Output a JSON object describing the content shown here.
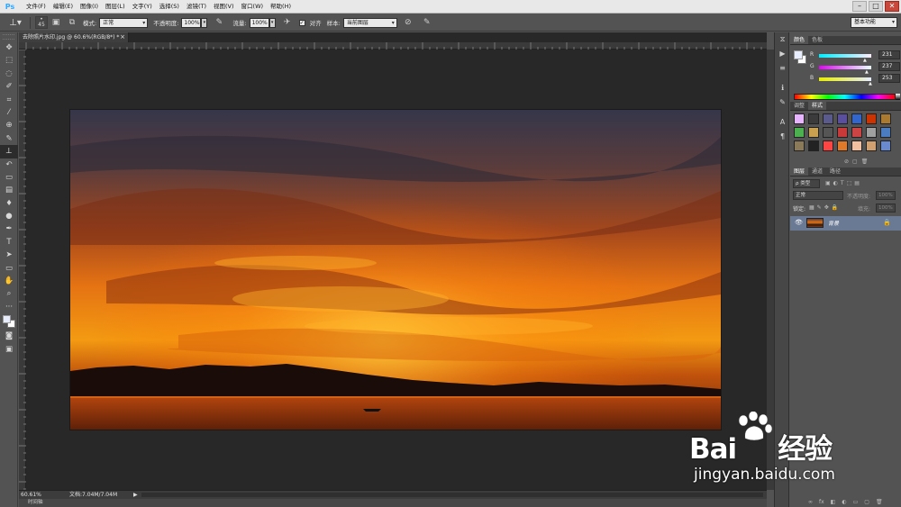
{
  "app": {
    "logo": "Ps",
    "menu": [
      "文件(F)",
      "编辑(E)",
      "图像(I)",
      "图层(L)",
      "文字(Y)",
      "选择(S)",
      "滤镜(T)",
      "视图(V)",
      "窗口(W)",
      "帮助(H)"
    ],
    "window_controls": [
      "–",
      "□",
      "✕"
    ]
  },
  "options_bar": {
    "brush_size": "45",
    "mode_label": "模式:",
    "mode_value": "正常",
    "opacity_label": "不透明度:",
    "opacity_value": "100%",
    "flow_label": "流量:",
    "flow_value": "100%",
    "aligned_label": "对齐",
    "sample_label": "样本:",
    "sample_value": "当前图层",
    "workspace": "基本功能"
  },
  "document": {
    "tab_title": "去除照片水印.jpg @ 60.6%(RGB/8*) *",
    "zoom": "60.61%",
    "doc_info": "文档:7.04M/7.04M",
    "bottom_label": "时间轴"
  },
  "color_panel": {
    "tabs": [
      "颜色",
      "色板"
    ],
    "r_label": "R",
    "r_value": "231",
    "g_label": "G",
    "g_value": "237",
    "b_label": "B",
    "b_value": "253",
    "fg_color": "#e7edfd"
  },
  "styles_panel": {
    "tabs": [
      "调整",
      "样式"
    ],
    "swatches": [
      "#e8b4ff",
      "#3b3b3b",
      "#5a5a8c",
      "#5a4f9f",
      "#3366cc",
      "#cc3300",
      "#aa7a30",
      "#4caf50",
      "#c8a050",
      "#555555",
      "#c83a3a",
      "#cc4444",
      "#a0a0a0",
      "#4c7cc0",
      "#8a7a5a",
      "#222222",
      "#ff4444",
      "#e07a2a",
      "#f0c0a0",
      "#d0a070",
      "#6a8ad0"
    ]
  },
  "layers_panel": {
    "tabs": [
      "图层",
      "通道",
      "路径"
    ],
    "filter_type": "ρ 类型",
    "blend_mode": "正常",
    "opacity_label": "不透明度:",
    "opacity_value": "100%",
    "lock_label": "锁定:",
    "fill_label": "填充:",
    "fill_value": "100%",
    "layer_name": "背景"
  },
  "toolbar": {
    "tools": [
      "move-tool",
      "marquee-tool",
      "lasso-tool",
      "quick-select-tool",
      "crop-tool",
      "eyedropper-tool",
      "healing-tool",
      "brush-tool",
      "clone-stamp-tool",
      "history-brush-tool",
      "eraser-tool",
      "gradient-tool",
      "blur-tool",
      "dodge-tool",
      "pen-tool",
      "type-tool",
      "path-select-tool",
      "shape-tool",
      "hand-tool",
      "zoom-tool"
    ],
    "active_tool": "clone-stamp-tool"
  },
  "watermark": {
    "brand": "Bai",
    "brand_cn": "经验",
    "url": "jingyan.baidu.com"
  }
}
